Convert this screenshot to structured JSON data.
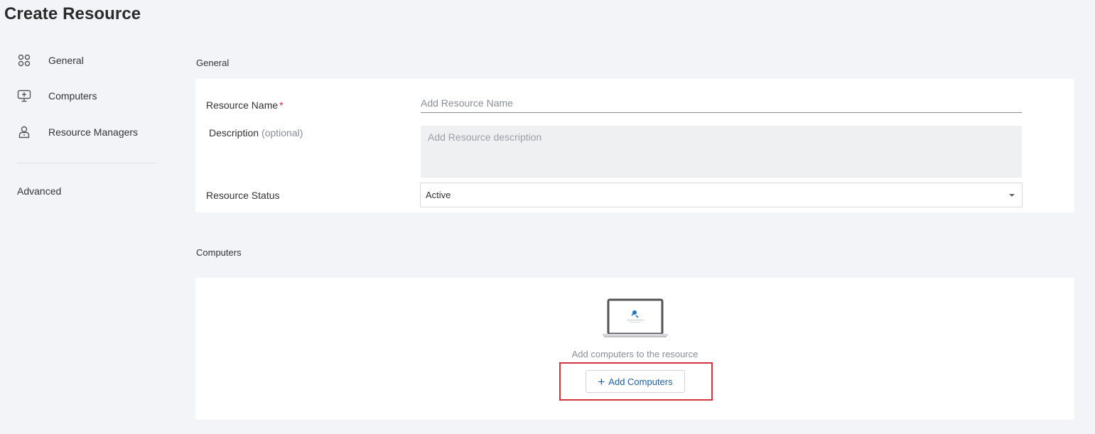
{
  "page": {
    "title": "Create Resource"
  },
  "sidebar": {
    "items": [
      {
        "label": "General",
        "icon": "grid-circles-icon"
      },
      {
        "label": "Computers",
        "icon": "monitor-add-icon"
      },
      {
        "label": "Resource Managers",
        "icon": "user-icon"
      }
    ],
    "advanced_label": "Advanced"
  },
  "general": {
    "section_label": "General",
    "resource_name": {
      "label": "Resource Name",
      "required_mark": "*",
      "placeholder": "Add Resource Name",
      "value": ""
    },
    "description": {
      "label": "Description",
      "optional_text": "(optional)",
      "placeholder": "Add Resource description",
      "value": ""
    },
    "status": {
      "label": "Resource Status",
      "selected": "Active"
    }
  },
  "computers": {
    "section_label": "Computers",
    "empty_text": "Add computers to the resource",
    "add_button_label": "Add Computers",
    "add_button_icon": "plus-icon"
  },
  "colors": {
    "background": "#f2f4f8",
    "card": "#ffffff",
    "accent": "#1f5fa8",
    "required": "#d9262e",
    "highlight": "#d1343c"
  }
}
